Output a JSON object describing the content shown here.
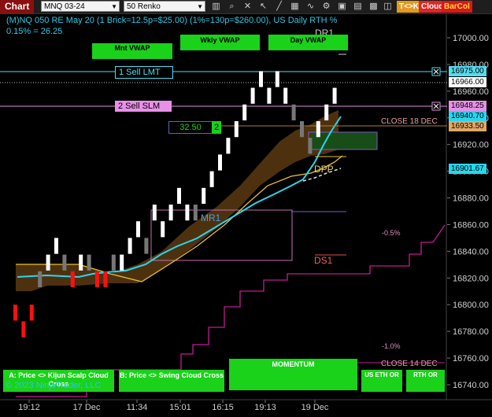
{
  "toolbar": {
    "title": "Chart",
    "instrument": "MNQ 03-24",
    "bar_type": "50 Renko",
    "tk_button": "T<>K",
    "cloud_button": "Cloud",
    "barcol_button": "BarCol"
  },
  "header": {
    "line1": "(M)NQ 050 RE May 20 (1 Brick=12.5p=$25.00) (1%=130p=$260.00), US Daily RTH %",
    "line2": "0.15% = 26.25"
  },
  "buttons": {
    "mnt_vwap": "Mnt VWAP",
    "wkly_vwap": "Wkly VWAP",
    "day_vwap": "Day VWAP",
    "kijun": "A: Price <> Kijun Scalp Cloud Cross",
    "swing": "B: Price <> Swing Cloud Cross",
    "momentum": "MOMENTUM",
    "us_eth": "US ETH OR",
    "rth_or": "RTH OR"
  },
  "orders": {
    "sell_lmt": "1 Sell LMT",
    "sell_slm": "2 Sell SLM",
    "pnl_value": "32.50",
    "pnl_qty": "2"
  },
  "labels": {
    "dr1": "DR1",
    "dpp": "DPP",
    "mr1": "MR1",
    "ds1": "DS1",
    "close18": "CLOSE 18 DEC",
    "close14": "CLOSE 14 DEC",
    "pct_neg05": "-0.5%",
    "pct_neg10": "-1.0%",
    "copyright": "© 2023 NinjaTrader, LLC"
  },
  "price_tags": {
    "sell_lmt": "16975.00",
    "last": "16966.00",
    "sell_slm": "16948.25",
    "cyan_line": "16940.70",
    "close18": "16933.50",
    "vwap": "16901.67"
  },
  "colors": {
    "up_brick": "#ffffff",
    "flat_brick": "#777777",
    "down_brick": "#ff1010",
    "cyan": "#29d6ee",
    "magenta": "#c21b8f",
    "orange_cloud": "#5a3a12",
    "button_green": "#19d219",
    "sell_lmt_tag": "#52dcf0",
    "sell_slm_tag": "#e08ee0"
  },
  "chart_data": {
    "type": "renko",
    "brick_size": 12.5,
    "y_axis": {
      "ylim": [
        16730,
        17010
      ],
      "ticks": [
        "17000.00",
        "16980.00",
        "16960.00",
        "16940.00",
        "16920.00",
        "16900.00",
        "16880.00",
        "16860.00",
        "16840.00",
        "16820.00",
        "16800.00",
        "16780.00",
        "16760.00",
        "16740.00"
      ]
    },
    "x_axis": {
      "ticks": [
        "19:12",
        "17 Dec",
        "11:34",
        "15:01",
        "16:15",
        "19:13",
        "19 Dec"
      ]
    },
    "bricks": [
      {
        "o": 16800,
        "c": 16787.5,
        "d": "down"
      },
      {
        "o": 16787.5,
        "c": 16775,
        "d": "down"
      },
      {
        "o": 16800,
        "c": 16787.5,
        "d": "down"
      },
      {
        "o": 16812.5,
        "c": 16825,
        "d": "flat"
      },
      {
        "o": 16825,
        "c": 16837.5,
        "d": "up"
      },
      {
        "o": 16837.5,
        "c": 16850,
        "d": "up"
      },
      {
        "o": 16837.5,
        "c": 16825,
        "d": "flat"
      },
      {
        "o": 16825,
        "c": 16812.5,
        "d": "down"
      },
      {
        "o": 16825,
        "c": 16837.5,
        "d": "up"
      },
      {
        "o": 16837.5,
        "c": 16825,
        "d": "flat"
      },
      {
        "o": 16825,
        "c": 16812.5,
        "d": "down"
      },
      {
        "o": 16825,
        "c": 16812.5,
        "d": "down"
      },
      {
        "o": 16837.5,
        "c": 16825,
        "d": "flat"
      },
      {
        "o": 16825,
        "c": 16837.5,
        "d": "up"
      },
      {
        "o": 16837.5,
        "c": 16850,
        "d": "up"
      },
      {
        "o": 16850,
        "c": 16862.5,
        "d": "up"
      },
      {
        "o": 16850,
        "c": 16837.5,
        "d": "flat"
      },
      {
        "o": 16862.5,
        "c": 16875,
        "d": "up"
      },
      {
        "o": 16862.5,
        "c": 16850,
        "d": "up"
      },
      {
        "o": 16862.5,
        "c": 16875,
        "d": "up"
      },
      {
        "o": 16875,
        "c": 16887.5,
        "d": "up"
      },
      {
        "o": 16875,
        "c": 16862.5,
        "d": "up"
      },
      {
        "o": 16862.5,
        "c": 16875,
        "d": "flat"
      },
      {
        "o": 16875,
        "c": 16887.5,
        "d": "up"
      },
      {
        "o": 16887.5,
        "c": 16900,
        "d": "up"
      },
      {
        "o": 16900,
        "c": 16912.5,
        "d": "up"
      },
      {
        "o": 16912.5,
        "c": 16925,
        "d": "up"
      },
      {
        "o": 16925,
        "c": 16937.5,
        "d": "up"
      },
      {
        "o": 16937.5,
        "c": 16950,
        "d": "up"
      },
      {
        "o": 16950,
        "c": 16962.5,
        "d": "up"
      },
      {
        "o": 16962.5,
        "c": 16975,
        "d": "up"
      },
      {
        "o": 16950,
        "c": 16962.5,
        "d": "up"
      },
      {
        "o": 16962.5,
        "c": 16975,
        "d": "up"
      },
      {
        "o": 16962.5,
        "c": 16950,
        "d": "up"
      },
      {
        "o": 16950,
        "c": 16937.5,
        "d": "flat"
      },
      {
        "o": 16937.5,
        "c": 16925,
        "d": "flat"
      },
      {
        "o": 16925,
        "c": 16912.5,
        "d": "flat"
      },
      {
        "o": 16925,
        "c": 16937.5,
        "d": "up"
      },
      {
        "o": 16937.5,
        "c": 16950,
        "d": "up"
      },
      {
        "o": 16950,
        "c": 16962.5,
        "d": "up"
      }
    ],
    "last_price": 16966.0
  }
}
